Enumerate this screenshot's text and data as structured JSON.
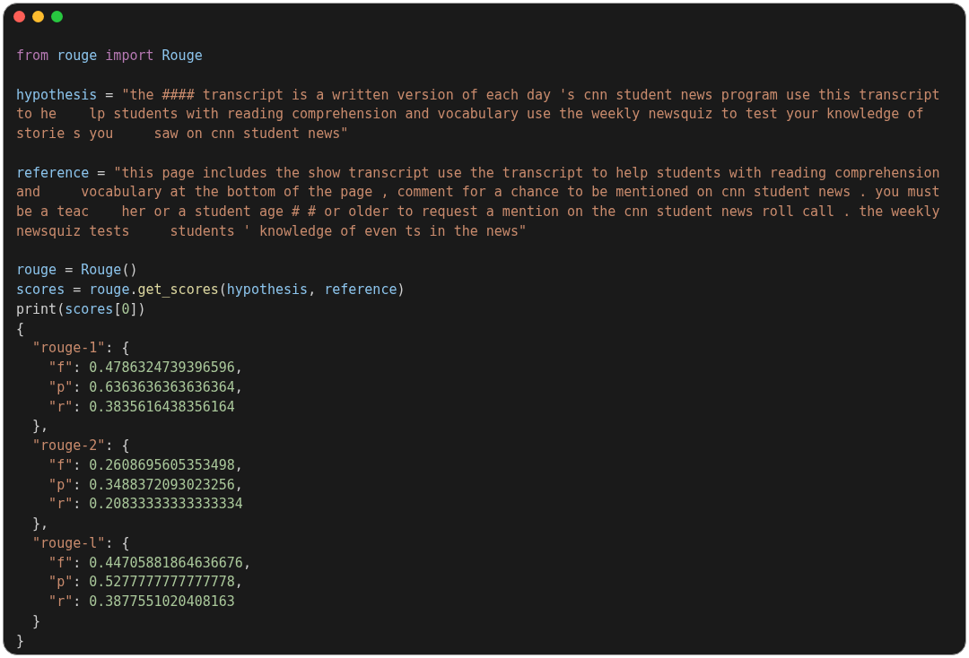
{
  "window": {
    "controls": [
      {
        "kind": "close"
      },
      {
        "kind": "minimize"
      },
      {
        "kind": "zoom"
      }
    ]
  },
  "code_lines": [
    {
      "kind": "code",
      "tokens": [
        {
          "kind": "keyword",
          "text": "from"
        },
        {
          "kind": "name",
          "text": " rouge"
        },
        {
          "kind": "keyword",
          "text": " import"
        },
        {
          "kind": "name",
          "text": " Rouge"
        }
      ]
    },
    {
      "kind": "blank"
    },
    {
      "kind": "code",
      "tokens": [
        {
          "kind": "name",
          "text": "hypothesis"
        },
        {
          "kind": "plain",
          "text": " = "
        },
        {
          "kind": "string",
          "text": "\"the #### transcript is a written version of each day 's cnn student news program use this transcript"
        }
      ]
    },
    {
      "kind": "code",
      "tokens": [
        {
          "kind": "string",
          "text": "to he    lp students with reading comprehension and vocabulary use the weekly newsquiz to test your knowledge of"
        }
      ]
    },
    {
      "kind": "code",
      "tokens": [
        {
          "kind": "string",
          "text": "storie s you     saw on cnn student news\""
        }
      ]
    },
    {
      "kind": "blank"
    },
    {
      "kind": "code",
      "tokens": [
        {
          "kind": "name",
          "text": "reference"
        },
        {
          "kind": "plain",
          "text": " = "
        },
        {
          "kind": "string",
          "text": "\"this page includes the show transcript use the transcript to help students with reading comprehension"
        }
      ]
    },
    {
      "kind": "code",
      "tokens": [
        {
          "kind": "string",
          "text": "and     vocabulary at the bottom of the page , comment for a chance to be mentioned on cnn student news . you must"
        }
      ]
    },
    {
      "kind": "code",
      "tokens": [
        {
          "kind": "string",
          "text": "be a teac    her or a student age # # or older to request a mention on the cnn student news roll call . the weekly"
        }
      ]
    },
    {
      "kind": "code",
      "tokens": [
        {
          "kind": "string",
          "text": "newsquiz tests     students ' knowledge of even ts in the news\""
        }
      ]
    },
    {
      "kind": "blank"
    },
    {
      "kind": "code",
      "tokens": [
        {
          "kind": "name",
          "text": "rouge"
        },
        {
          "kind": "plain",
          "text": " = "
        },
        {
          "kind": "name",
          "text": "Rouge"
        },
        {
          "kind": "plain",
          "text": "()"
        }
      ]
    },
    {
      "kind": "code",
      "tokens": [
        {
          "kind": "name",
          "text": "scores"
        },
        {
          "kind": "plain",
          "text": " = "
        },
        {
          "kind": "name",
          "text": "rouge"
        },
        {
          "kind": "plain",
          "text": "."
        },
        {
          "kind": "func",
          "text": "get_scores"
        },
        {
          "kind": "plain",
          "text": "("
        },
        {
          "kind": "name",
          "text": "hypothesis"
        },
        {
          "kind": "plain",
          "text": ", "
        },
        {
          "kind": "name",
          "text": "reference"
        },
        {
          "kind": "plain",
          "text": ")"
        }
      ]
    },
    {
      "kind": "code",
      "tokens": [
        {
          "kind": "plain",
          "text": "print("
        },
        {
          "kind": "name",
          "text": "scores"
        },
        {
          "kind": "plain",
          "text": "["
        },
        {
          "kind": "number",
          "text": "0"
        },
        {
          "kind": "plain",
          "text": "])"
        }
      ]
    },
    {
      "kind": "code",
      "tokens": [
        {
          "kind": "plain",
          "text": "{"
        }
      ]
    },
    {
      "kind": "code",
      "tokens": [
        {
          "kind": "string",
          "text": "  \"rouge-1\""
        },
        {
          "kind": "plain",
          "text": ": {"
        }
      ]
    },
    {
      "kind": "code",
      "tokens": [
        {
          "kind": "string",
          "text": "    \"f\""
        },
        {
          "kind": "plain",
          "text": ": "
        },
        {
          "kind": "number",
          "text": "0.4786324739396596"
        },
        {
          "kind": "plain",
          "text": ","
        }
      ]
    },
    {
      "kind": "code",
      "tokens": [
        {
          "kind": "string",
          "text": "    \"p\""
        },
        {
          "kind": "plain",
          "text": ": "
        },
        {
          "kind": "number",
          "text": "0.6363636363636364"
        },
        {
          "kind": "plain",
          "text": ","
        }
      ]
    },
    {
      "kind": "code",
      "tokens": [
        {
          "kind": "string",
          "text": "    \"r\""
        },
        {
          "kind": "plain",
          "text": ": "
        },
        {
          "kind": "number",
          "text": "0.3835616438356164"
        }
      ]
    },
    {
      "kind": "code",
      "tokens": [
        {
          "kind": "plain",
          "text": "  },"
        }
      ]
    },
    {
      "kind": "code",
      "tokens": [
        {
          "kind": "string",
          "text": "  \"rouge-2\""
        },
        {
          "kind": "plain",
          "text": ": {"
        }
      ]
    },
    {
      "kind": "code",
      "tokens": [
        {
          "kind": "string",
          "text": "    \"f\""
        },
        {
          "kind": "plain",
          "text": ": "
        },
        {
          "kind": "number",
          "text": "0.2608695605353498"
        },
        {
          "kind": "plain",
          "text": ","
        }
      ]
    },
    {
      "kind": "code",
      "tokens": [
        {
          "kind": "string",
          "text": "    \"p\""
        },
        {
          "kind": "plain",
          "text": ": "
        },
        {
          "kind": "number",
          "text": "0.3488372093023256"
        },
        {
          "kind": "plain",
          "text": ","
        }
      ]
    },
    {
      "kind": "code",
      "tokens": [
        {
          "kind": "string",
          "text": "    \"r\""
        },
        {
          "kind": "plain",
          "text": ": "
        },
        {
          "kind": "number",
          "text": "0.20833333333333334"
        }
      ]
    },
    {
      "kind": "code",
      "tokens": [
        {
          "kind": "plain",
          "text": "  },"
        }
      ]
    },
    {
      "kind": "code",
      "tokens": [
        {
          "kind": "string",
          "text": "  \"rouge-l\""
        },
        {
          "kind": "plain",
          "text": ": {"
        }
      ]
    },
    {
      "kind": "code",
      "tokens": [
        {
          "kind": "string",
          "text": "    \"f\""
        },
        {
          "kind": "plain",
          "text": ": "
        },
        {
          "kind": "number",
          "text": "0.44705881864636676"
        },
        {
          "kind": "plain",
          "text": ","
        }
      ]
    },
    {
      "kind": "code",
      "tokens": [
        {
          "kind": "string",
          "text": "    \"p\""
        },
        {
          "kind": "plain",
          "text": ": "
        },
        {
          "kind": "number",
          "text": "0.5277777777777778"
        },
        {
          "kind": "plain",
          "text": ","
        }
      ]
    },
    {
      "kind": "code",
      "tokens": [
        {
          "kind": "string",
          "text": "    \"r\""
        },
        {
          "kind": "plain",
          "text": ": "
        },
        {
          "kind": "number",
          "text": "0.3877551020408163"
        }
      ]
    },
    {
      "kind": "code",
      "tokens": [
        {
          "kind": "plain",
          "text": "  }"
        }
      ]
    },
    {
      "kind": "code",
      "tokens": [
        {
          "kind": "plain",
          "text": "}"
        }
      ]
    }
  ]
}
